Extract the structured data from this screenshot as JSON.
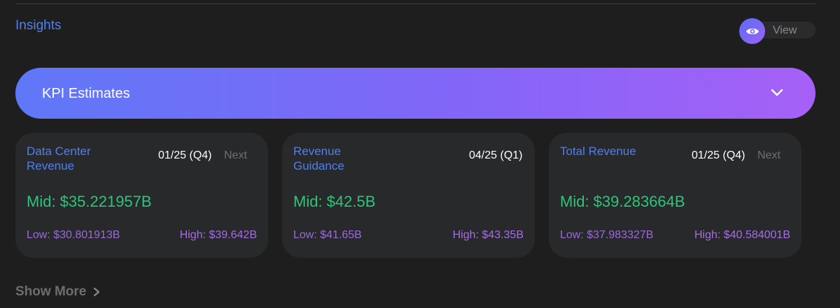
{
  "section": {
    "title": "Insights"
  },
  "view_toggle": {
    "label": "View",
    "icon": "eye-icon"
  },
  "kpi_banner": {
    "title": "KPI Estimates",
    "icon": "chevron-down-icon"
  },
  "cards": [
    {
      "title": "Data Center Revenue",
      "period": "01/25 (Q4)",
      "next": "Next",
      "mid": "Mid: $35.221957B",
      "low": "Low: $30.801913B",
      "high": "High: $39.642B"
    },
    {
      "title": "Revenue Guidance",
      "period": "04/25 (Q1)",
      "next": "",
      "mid": "Mid: $42.5B",
      "low": "Low: $41.65B",
      "high": "High: $43.35B"
    },
    {
      "title": "Total Revenue",
      "period": "01/25 (Q4)",
      "next": "Next",
      "mid": "Mid: $39.283664B",
      "low": "Low: $37.983327B",
      "high": "High: $40.584001B"
    }
  ],
  "show_more": {
    "label": "Show More",
    "icon": "chevron-right-icon"
  },
  "colors": {
    "background": "#1e1e1f",
    "card": "#28292b",
    "accent_blue": "#4f7ff0",
    "mid_green": "#2ec47a",
    "range_purple": "#a66ce6",
    "banner_start": "#5f78f7",
    "banner_end": "#a660f7"
  }
}
